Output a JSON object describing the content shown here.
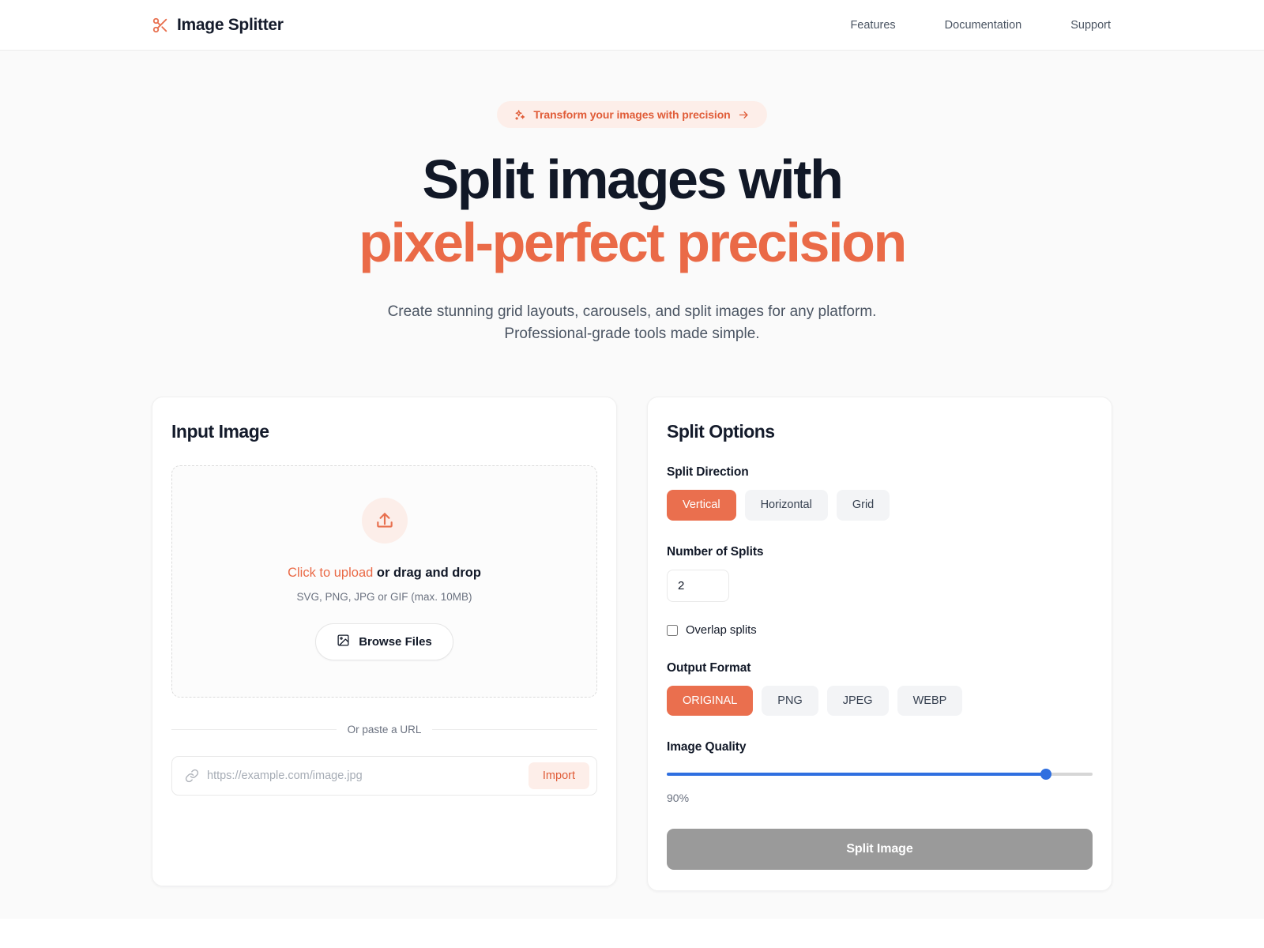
{
  "header": {
    "brand_name": "Image Splitter",
    "brand_icon": "scissors-icon",
    "nav": [
      {
        "label": "Features"
      },
      {
        "label": "Documentation"
      },
      {
        "label": "Support"
      }
    ]
  },
  "hero": {
    "badge": {
      "icon": "sparkles-icon",
      "text": "Transform your images with precision",
      "arrow": "→"
    },
    "headline_line1": "Split images with",
    "headline_line2": "pixel-perfect precision",
    "subhead_line1": "Create stunning grid layouts, carousels, and split images for any platform.",
    "subhead_line2": "Professional-grade tools made simple.",
    "accent_color": "#ea6a47"
  },
  "input_panel": {
    "title": "Input Image",
    "dropzone": {
      "icon": "upload-icon",
      "main_accent": "Click to upload",
      "main_rest": " or drag and drop",
      "formats": "SVG, PNG, JPG or GIF (max. 10MB)",
      "browse_label": "Browse Files",
      "browse_icon": "image-icon"
    },
    "divider_label": "Or paste a URL",
    "url": {
      "icon": "link-icon",
      "placeholder": "https://example.com/image.jpg",
      "value": "",
      "import_label": "Import"
    }
  },
  "options_panel": {
    "title": "Split Options",
    "split_direction": {
      "label": "Split Direction",
      "options": [
        "Vertical",
        "Horizontal",
        "Grid"
      ],
      "selected": "Vertical"
    },
    "number_of_splits": {
      "label": "Number of Splits",
      "value": "2"
    },
    "overlap": {
      "label": "Overlap splits",
      "checked": false
    },
    "output_format": {
      "label": "Output Format",
      "options": [
        "ORIGINAL",
        "PNG",
        "JPEG",
        "WEBP"
      ],
      "selected": "ORIGINAL"
    },
    "image_quality": {
      "label": "Image Quality",
      "value": 90,
      "value_text": "90%",
      "min": 0,
      "max": 100,
      "track_color": "#2f6fe0"
    },
    "submit": {
      "label": "Split Image",
      "enabled": false,
      "color": "#9a9a9a"
    }
  }
}
